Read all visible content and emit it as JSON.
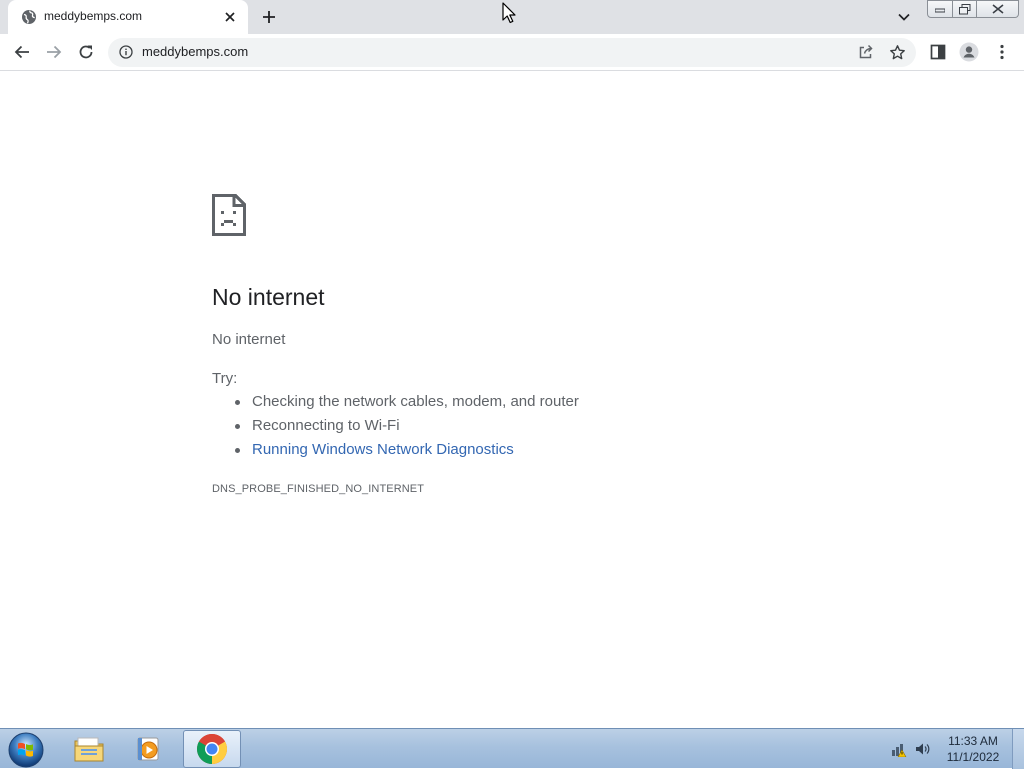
{
  "browser": {
    "tab": {
      "title": "meddybemps.com"
    },
    "address_bar": {
      "url": "meddybemps.com"
    }
  },
  "page": {
    "heading": "No internet",
    "subheading": "No internet",
    "try_label": "Try:",
    "suggestions": [
      "Checking the network cables, modem, and router",
      "Reconnecting to Wi-Fi",
      "Running Windows Network Diagnostics"
    ],
    "error_code": "DNS_PROBE_FINISHED_NO_INTERNET"
  },
  "taskbar": {
    "clock": {
      "time": "11:33 AM",
      "date": "11/1/2022"
    }
  },
  "colors": {
    "link": "#3367b2",
    "text_secondary": "#5f6368",
    "title_bar": "#dfe1e5"
  },
  "icons": {
    "tab_favicon": "globe-icon",
    "page_error": "sad-page-icon",
    "address_info": "info-icon"
  }
}
